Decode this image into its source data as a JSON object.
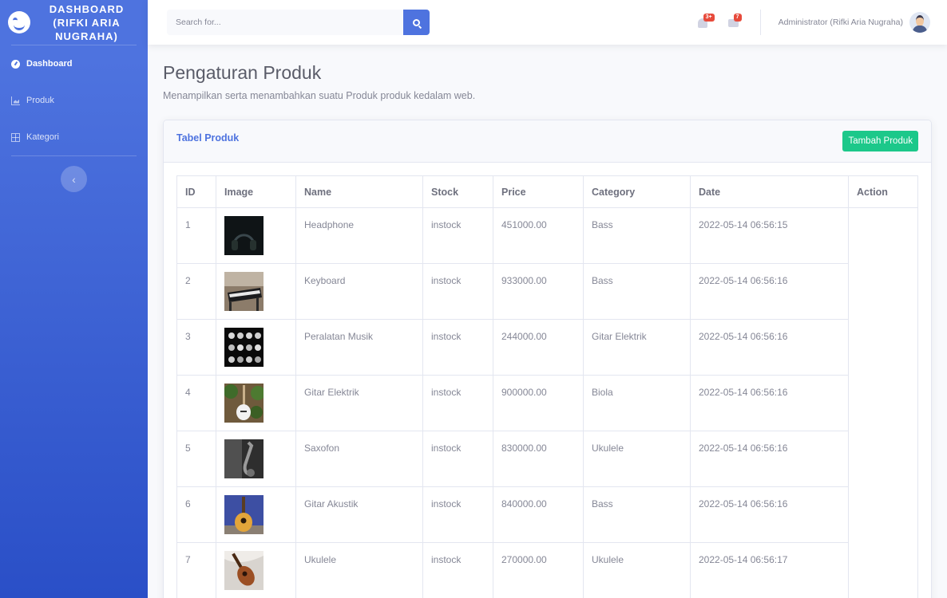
{
  "brand": {
    "text": "DASHBOARD (RIFKI ARIA NUGRAHA)",
    "icon": "laugh-wink-icon"
  },
  "sidebar": {
    "items": [
      {
        "label": "Dashboard",
        "icon": "tachometer-icon",
        "active": true
      },
      {
        "label": "Produk",
        "icon": "chart-area-icon",
        "active": false
      },
      {
        "label": "Kategori",
        "icon": "table-icon",
        "active": false
      }
    ],
    "toggle_icon": "chevron-left-icon"
  },
  "topbar": {
    "search_placeholder": "Search for...",
    "alerts_badge": "3+",
    "messages_badge": "7",
    "user_name": "Administrator (Rifki Aria Nugraha)"
  },
  "page": {
    "title": "Pengaturan Produk",
    "subtitle": "Menampilkan serta menambahkan suatu Produk produk kedalam web."
  },
  "card": {
    "title": "Tabel Produk",
    "add_button": "Tambah Produk"
  },
  "table": {
    "headers": [
      "ID",
      "Image",
      "Name",
      "Stock",
      "Price",
      "Category",
      "Date",
      "Action"
    ],
    "rows": [
      {
        "id": "1",
        "name": "Headphone",
        "stock": "instock",
        "price": "451000.00",
        "category": "Bass",
        "date": "2022-05-14 06:56:15"
      },
      {
        "id": "2",
        "name": "Keyboard",
        "stock": "instock",
        "price": "933000.00",
        "category": "Bass",
        "date": "2022-05-14 06:56:16"
      },
      {
        "id": "3",
        "name": "Peralatan Musik",
        "stock": "instock",
        "price": "244000.00",
        "category": "Gitar Elektrik",
        "date": "2022-05-14 06:56:16"
      },
      {
        "id": "4",
        "name": "Gitar Elektrik",
        "stock": "instock",
        "price": "900000.00",
        "category": "Biola",
        "date": "2022-05-14 06:56:16"
      },
      {
        "id": "5",
        "name": "Saxofon",
        "stock": "instock",
        "price": "830000.00",
        "category": "Ukulele",
        "date": "2022-05-14 06:56:16"
      },
      {
        "id": "6",
        "name": "Gitar Akustik",
        "stock": "instock",
        "price": "840000.00",
        "category": "Bass",
        "date": "2022-05-14 06:56:16"
      },
      {
        "id": "7",
        "name": "Ukulele",
        "stock": "instock",
        "price": "270000.00",
        "category": "Ukulele",
        "date": "2022-05-14 06:56:17"
      }
    ]
  }
}
